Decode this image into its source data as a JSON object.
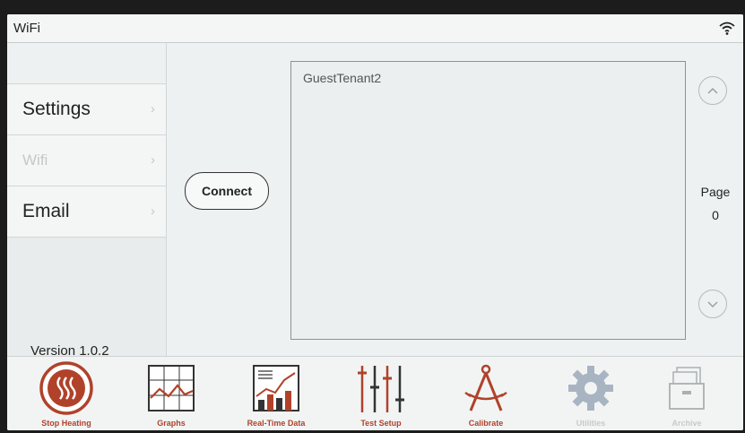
{
  "window": {
    "title": "WiFi"
  },
  "sidebar": {
    "items": [
      {
        "label": "Settings",
        "enabled": true
      },
      {
        "label": "Wifi",
        "enabled": false
      },
      {
        "label": "Email",
        "enabled": true
      }
    ],
    "version": "Version 1.0.2"
  },
  "actions": {
    "connect_label": "Connect"
  },
  "networks": [
    "GuestTenant2"
  ],
  "paging": {
    "label": "Page",
    "number": "0"
  },
  "toolbar": {
    "items": [
      {
        "label": "Stop Heating",
        "icon": "heating-icon",
        "enabled": true
      },
      {
        "label": "Graphs",
        "icon": "graph-icon",
        "enabled": true
      },
      {
        "label": "Real-Time Data",
        "icon": "realtime-data-icon",
        "enabled": true
      },
      {
        "label": "Test Setup",
        "icon": "sliders-icon",
        "enabled": true
      },
      {
        "label": "Calibrate",
        "icon": "compass-icon",
        "enabled": true
      },
      {
        "label": "Utilities",
        "icon": "gear-icon",
        "enabled": false
      },
      {
        "label": "Archive",
        "icon": "archive-icon",
        "enabled": false
      }
    ]
  },
  "colors": {
    "accent": "#b0422a",
    "dim": "#c6caca",
    "background": "#eef1f1"
  }
}
